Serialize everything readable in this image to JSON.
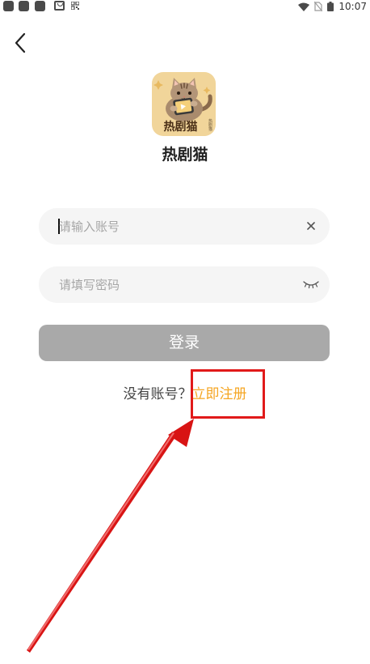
{
  "status_bar": {
    "time": "10:07"
  },
  "nav": {
    "back_icon": "chevron-left-icon"
  },
  "app": {
    "logo_text": "热剧猫",
    "logo_stamp": "热剧猫",
    "name": "热剧猫"
  },
  "form": {
    "account_placeholder": "请输入账号",
    "account_value": "",
    "password_placeholder": "请填写密码",
    "password_value": "",
    "clear_icon": "close-icon",
    "visibility_icon": "eye-closed-icon",
    "login_label": "登录"
  },
  "register": {
    "prompt": "没有账号？",
    "link": "立即注册"
  },
  "colors": {
    "accent": "#f5a623",
    "button_disabled": "#a9a9a9",
    "field_background": "#f5f5f5",
    "annotation": "#e11a1a"
  }
}
